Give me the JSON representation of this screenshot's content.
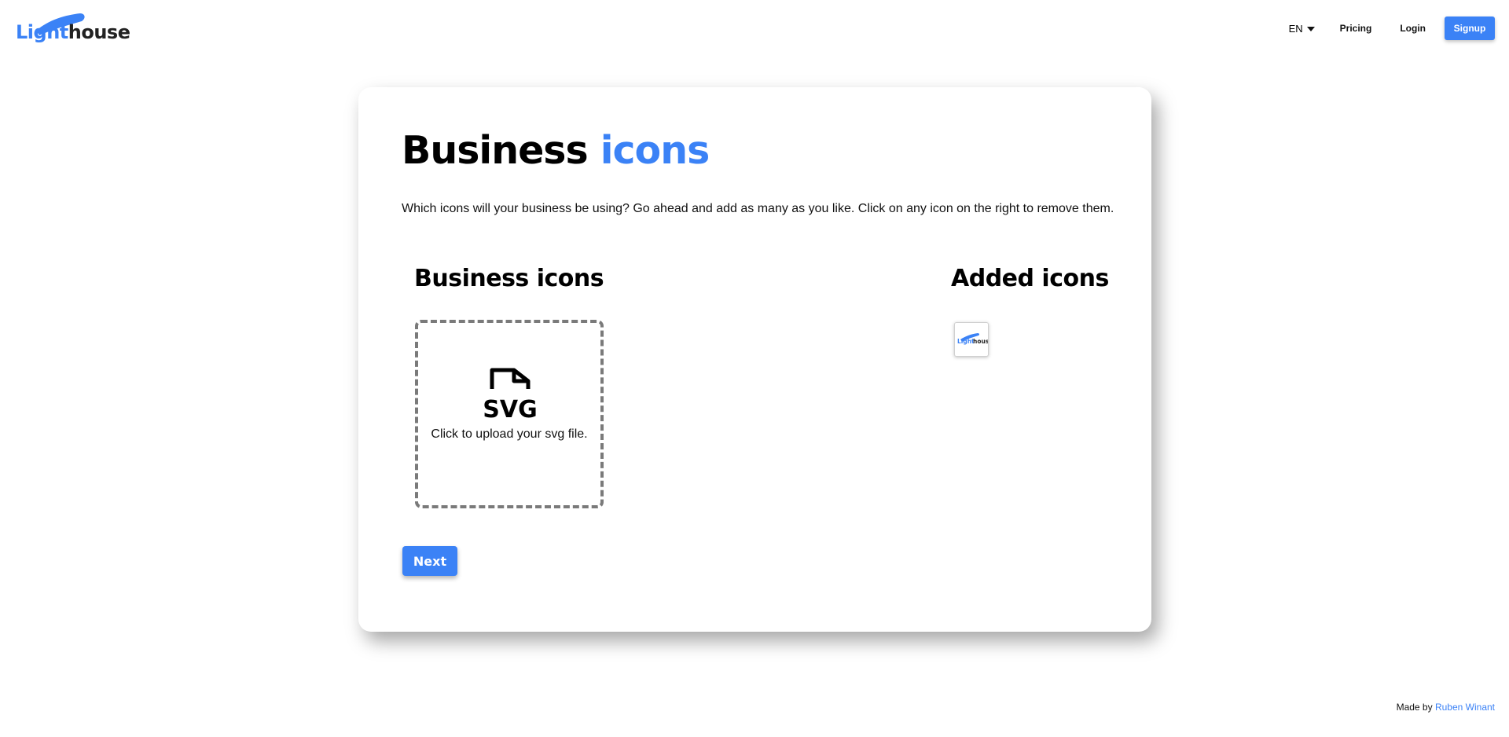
{
  "brand": {
    "logo_light": "Light",
    "logo_house": "house",
    "accent_color": "#3b82f6"
  },
  "nav": {
    "language": "EN",
    "pricing": "Pricing",
    "login": "Login",
    "signup": "Signup"
  },
  "main": {
    "title_part1": "Business",
    "title_part2": "icons",
    "description": "Which icons will your business be using? Go ahead and add as many as you like. Click on any icon on the right to remove them.",
    "left_heading": "Business icons",
    "right_heading": "Added icons",
    "upload_icon": "svg-file-icon",
    "upload_text": "Click to upload your svg file.",
    "added_icons": [
      {
        "name": "lighthouse-logo-icon"
      }
    ],
    "next_label": "Next"
  },
  "footer": {
    "made_by": "Made by",
    "author": "Ruben Winant"
  }
}
